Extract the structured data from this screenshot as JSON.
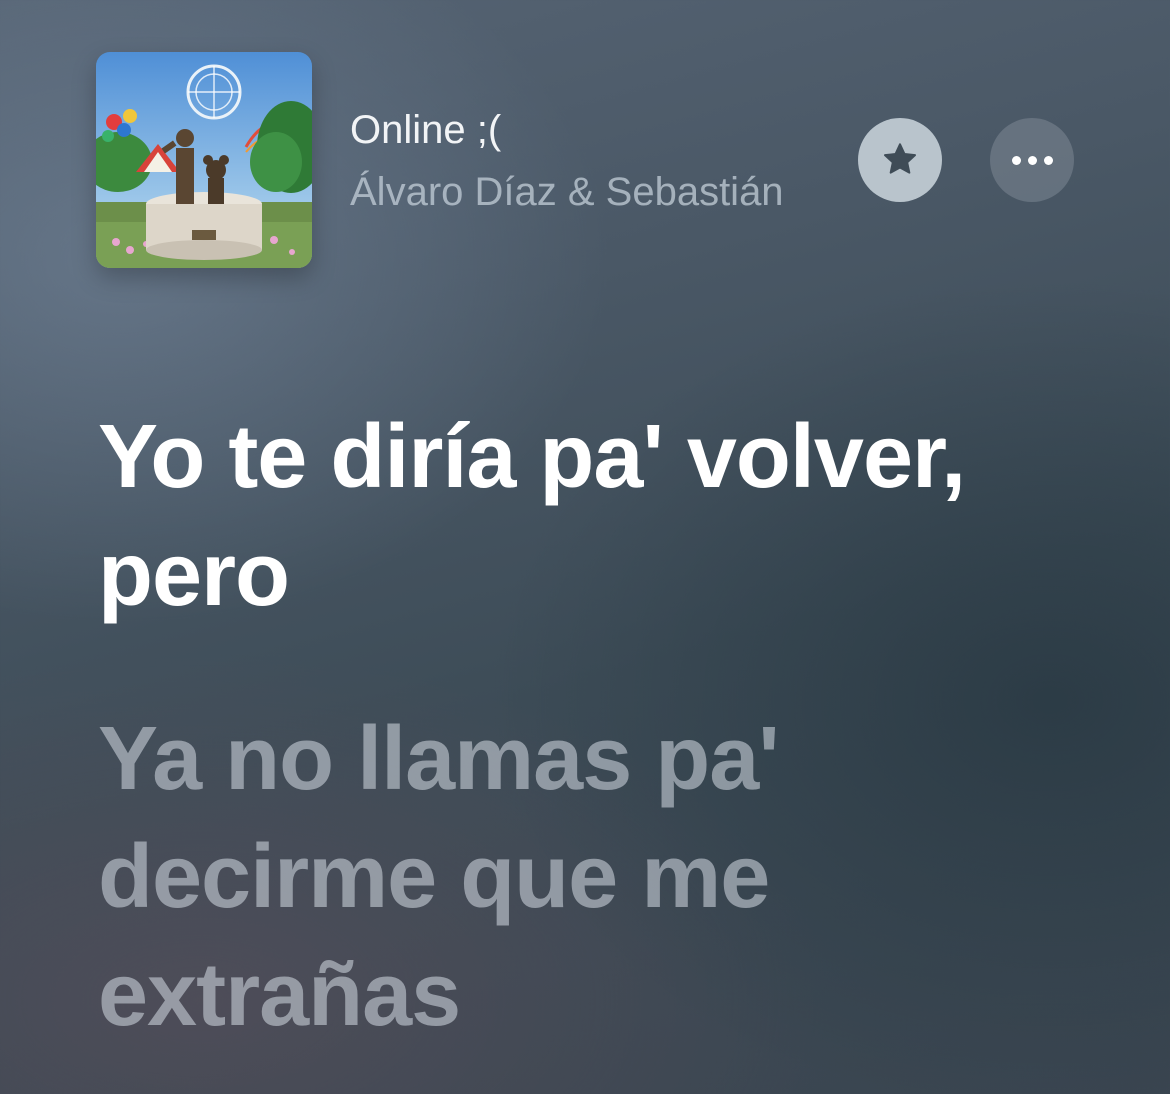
{
  "now_playing": {
    "title": "Online ;(",
    "artist": "Álvaro Díaz & Sebastián",
    "artwork_icon": "album-artwork",
    "favorite_icon": "star-icon",
    "more_icon": "ellipsis-icon"
  },
  "lyrics": {
    "lines": [
      {
        "text": "Yo te diría pa' volver, pero",
        "state": "active"
      },
      {
        "text": "Ya no llamas pa' decirme que me extrañas",
        "state": "upcoming"
      }
    ]
  },
  "colors": {
    "active_lyric": "#ffffff",
    "upcoming_lyric": "#a9b1ba",
    "favorite_button": "#b9c4cc",
    "icon_dark": "#3f4c57"
  }
}
